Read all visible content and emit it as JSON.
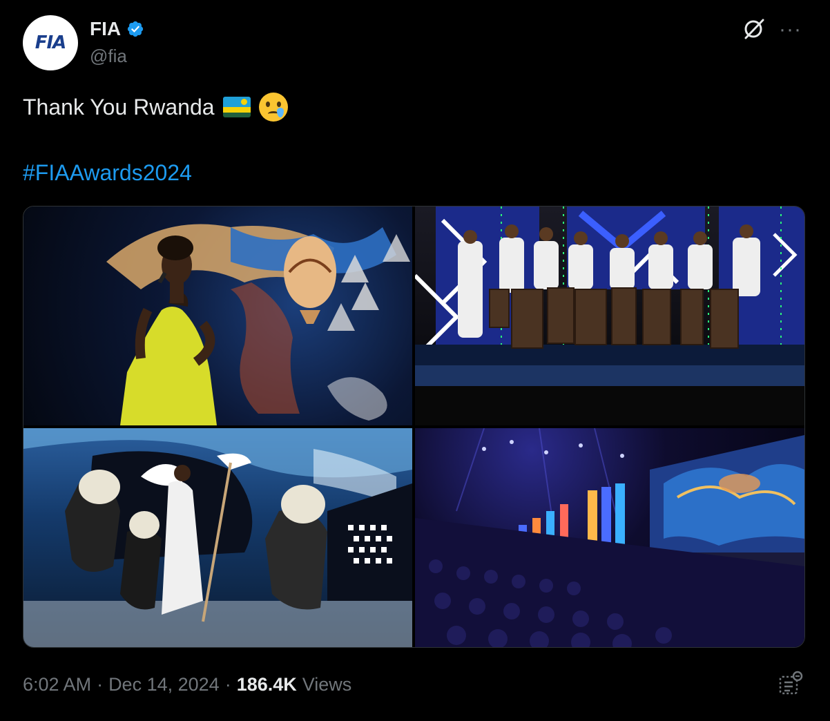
{
  "author": {
    "name": "FIA",
    "handle": "@fia",
    "avatar_text": "FIA",
    "verified": true
  },
  "header": {
    "grok_icon": "grok-icon",
    "more_icon": "more-icon",
    "more_label": "···"
  },
  "tweet": {
    "text": "Thank You Rwanda",
    "emojis": [
      "rwanda-flag",
      "face-holding-back-tears"
    ],
    "hashtag": "#FIAAwards2024"
  },
  "media": {
    "photos": [
      {
        "name": "singer-on-stage-photo"
      },
      {
        "name": "drummers-performance-photo"
      },
      {
        "name": "traditional-dancers-photo"
      },
      {
        "name": "audience-arena-photo"
      }
    ]
  },
  "footer": {
    "time": "6:02 AM",
    "separator1": "·",
    "date": "Dec 14, 2024",
    "separator2": "·",
    "views_count": "186.4K",
    "views_label": "Views"
  },
  "colors": {
    "background": "#000000",
    "text": "#e7e9ea",
    "secondary": "#71767b",
    "link": "#1d9bf0",
    "verified": "#1d9bf0"
  }
}
